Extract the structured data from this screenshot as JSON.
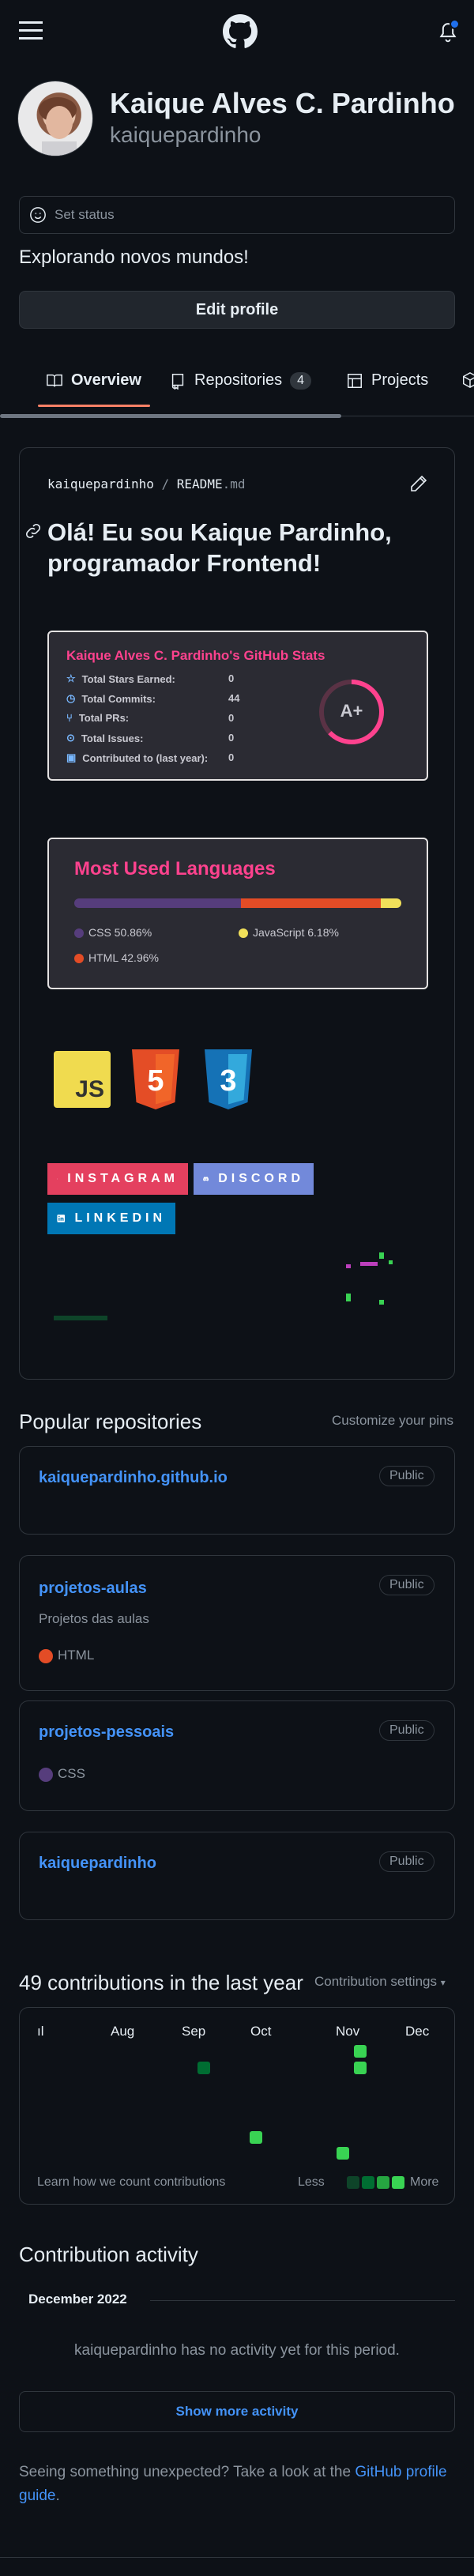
{
  "header": {
    "menu_icon": "hamburger-icon",
    "logo_icon": "github-logo-icon",
    "bell_icon": "bell-icon"
  },
  "profile": {
    "name": "Kaique Alves C. Pardinho",
    "username": "kaiquepardinho",
    "status_placeholder": "Set status",
    "bio": "Explorando novos mundos!",
    "edit_label": "Edit profile"
  },
  "tabs": [
    {
      "label": "Overview",
      "icon": "book-icon"
    },
    {
      "label": "Repositories",
      "icon": "repo-icon",
      "count": "4"
    },
    {
      "label": "Projects",
      "icon": "table-icon"
    }
  ],
  "readme": {
    "path_user": "kaiquepardinho",
    "path_sep": "/",
    "path_file": "README",
    "path_ext": ".md",
    "heading": "Olá! Eu sou Kaique Pardinho, programador Frontend!"
  },
  "stats_card": {
    "title": "Kaique Alves C. Pardinho's GitHub Stats",
    "rows": [
      {
        "label": "Total Stars Earned:",
        "value": "0",
        "icon": "star-icon"
      },
      {
        "label": "Total Commits:",
        "value": "44",
        "icon": "history-icon"
      },
      {
        "label": "Total PRs:",
        "value": "0",
        "icon": "pull-request-icon"
      },
      {
        "label": "Total Issues:",
        "value": "0",
        "icon": "issue-icon"
      },
      {
        "label": "Contributed to (last year):",
        "value": "0",
        "icon": "repo-icon"
      }
    ],
    "grade": "A+",
    "accent": "#fe428e"
  },
  "languages_card": {
    "title": "Most Used Languages",
    "langs": [
      {
        "label": "CSS 50.86%",
        "name": "CSS",
        "percent": 50.86,
        "color": "#563d7c"
      },
      {
        "label": "JavaScript 6.18%",
        "name": "JavaScript",
        "percent": 6.18,
        "color": "#f1e05a"
      },
      {
        "label": "HTML 42.96%",
        "name": "HTML",
        "percent": 42.96,
        "color": "#e34c26"
      }
    ]
  },
  "tech_icons": [
    "JS",
    "5",
    "3"
  ],
  "social": [
    {
      "label": "INSTAGRAM",
      "color": "#e4405f",
      "icon": "instagram-icon"
    },
    {
      "label": "DISCORD",
      "color": "#7289da",
      "icon": "discord-icon"
    },
    {
      "label": "LINKEDIN",
      "color": "#0077b5",
      "icon": "linkedin-icon"
    }
  ],
  "popular": {
    "title": "Popular repositories",
    "customize": "Customize your pins",
    "repos": [
      {
        "name": "kaiquepardinho.github.io",
        "visibility": "Public",
        "description": "",
        "language": ""
      },
      {
        "name": "projetos-aulas",
        "visibility": "Public",
        "description": "Projetos das aulas",
        "language": "HTML",
        "lang_color": "#e34c26"
      },
      {
        "name": "projetos-pessoais",
        "visibility": "Public",
        "description": "",
        "language": "CSS",
        "lang_color": "#563d7c"
      },
      {
        "name": "kaiquepardinho",
        "visibility": "Public",
        "description": "",
        "language": ""
      }
    ]
  },
  "contributions": {
    "title": "49 contributions in the last year",
    "settings": "Contribution settings",
    "months": [
      "ıl",
      "Aug",
      "Sep",
      "Oct",
      "Nov",
      "Dec"
    ],
    "learn": "Learn how we count contributions",
    "less": "Less",
    "more": "More"
  },
  "activity": {
    "title": "Contribution activity",
    "month": "December 2022",
    "empty": "kaiquepardinho has no activity yet for this period.",
    "show_more": "Show more activity"
  },
  "footer": {
    "text": "Seeing something unexpected? Take a look at the ",
    "link": "GitHub profile guide",
    "end": "."
  }
}
